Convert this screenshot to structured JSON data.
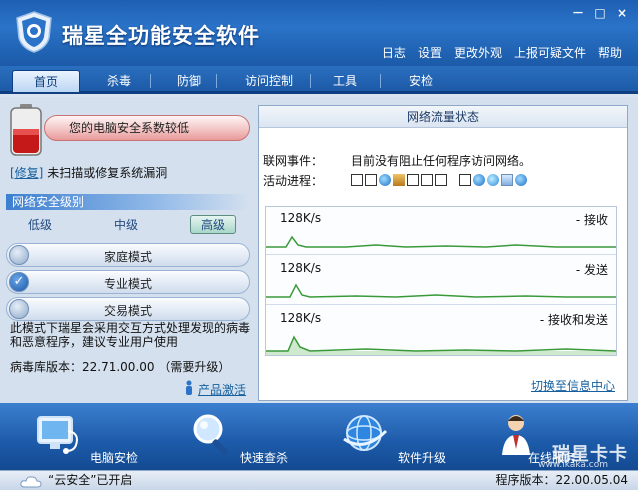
{
  "app": {
    "title": "瑞星全功能安全软件",
    "window_buttons": [
      "－",
      "□",
      "×"
    ]
  },
  "top_links": [
    "日志",
    "设置",
    "更改外观",
    "上报可疑文件",
    "帮助"
  ],
  "tabs": [
    {
      "label": "首页",
      "active": true
    },
    {
      "label": "杀毒"
    },
    {
      "label": "防御"
    },
    {
      "label": "访问控制"
    },
    {
      "label": "工具"
    },
    {
      "label": "安检"
    }
  ],
  "left": {
    "alert_text": "您的电脑安全系数较低",
    "fix_link": "[修复]",
    "fix_desc": "未扫描或修复系统漏洞",
    "section_title": "网络安全级别",
    "levels": [
      {
        "label": "低级"
      },
      {
        "label": "中级"
      },
      {
        "label": "高级",
        "active": true
      }
    ],
    "modes": [
      {
        "label": "家庭模式",
        "checked": false
      },
      {
        "label": "专业模式",
        "checked": true
      },
      {
        "label": "交易模式",
        "checked": false
      }
    ],
    "mode_desc": "此模式下瑞星会采用交互方式处理发现的病毒和恶意程序，建议专业用户使用",
    "db_version": "病毒库版本：22.71.00.00 （需要升级）",
    "activate_link": "产品激活"
  },
  "right": {
    "title": "网络流量状态",
    "net_event_label": "联网事件：",
    "net_event_value": "目前没有阻止任何程序访问网络。",
    "active_proc_label": "活动进程：",
    "traffic": [
      {
        "speed": "128K/s",
        "name": "- 接收"
      },
      {
        "speed": "128K/s",
        "name": "- 发送"
      },
      {
        "speed": "128K/s",
        "name": "- 接收和发送"
      }
    ],
    "switch_link": "切换至信息中心"
  },
  "toolbar": [
    {
      "label": "电脑安检",
      "icon": "monitor-stethoscope-icon"
    },
    {
      "label": "快速查杀",
      "icon": "magnifier-icon"
    },
    {
      "label": "软件升级",
      "icon": "globe-upgrade-icon"
    },
    {
      "label": "在线服务",
      "icon": "support-agent-icon"
    }
  ],
  "status": {
    "cloud": "“云安全”已开启",
    "program_version": "程序版本：22.00.05.04"
  },
  "watermark": {
    "main": "瑞星卡卡",
    "sub": "www.ikaka.com"
  },
  "colors": {
    "brand_blue": "#1e5fb3",
    "alert_red": "#e99a9a",
    "graph_green": "#3a9a3a"
  }
}
